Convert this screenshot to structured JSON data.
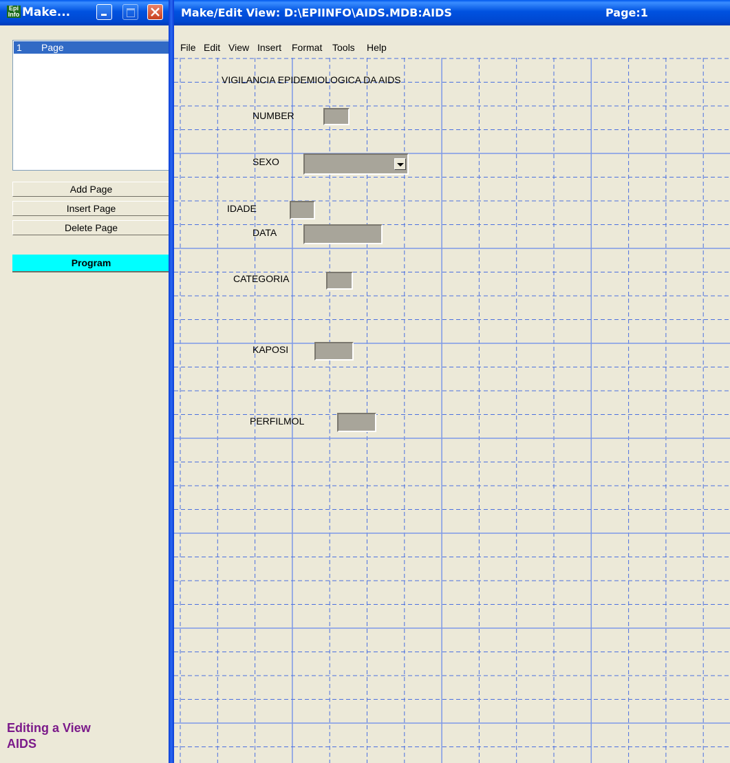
{
  "left_window": {
    "title": "Make...",
    "app_icon_text": "Epi\nInfo",
    "pages": [
      {
        "number": "1",
        "label": "Page"
      }
    ],
    "buttons": {
      "add_page": "Add Page",
      "insert_page": "Insert Page",
      "delete_page": "Delete Page",
      "program": "Program"
    },
    "status_line1": "Editing a View",
    "status_line2": "AIDS"
  },
  "main_window": {
    "title": "Make/Edit View: D:\\EPIINFO\\AIDS.MDB:AIDS",
    "page_label": "Page:1",
    "menu": [
      "File",
      "Edit",
      "View",
      "Insert",
      "Format",
      "Tools",
      "Help"
    ]
  },
  "form": {
    "heading": "VIGILANCIA EPIDEMIOLOGICA DA AIDS",
    "fields": {
      "number": "NUMBER",
      "sexo": "SEXO",
      "idade": "IDADE",
      "data": "DATA",
      "categoria": "CATEGORIA",
      "kaposi": "KAPOSI",
      "perfilmol": "PERFILMOL"
    }
  },
  "colors": {
    "titlebar_blue": "#0052E0",
    "program_button": "#00FFFF",
    "status_text": "#7B1A8A",
    "grid_dashed": "#4A6FE0",
    "grid_solid": "#7C98E8"
  }
}
